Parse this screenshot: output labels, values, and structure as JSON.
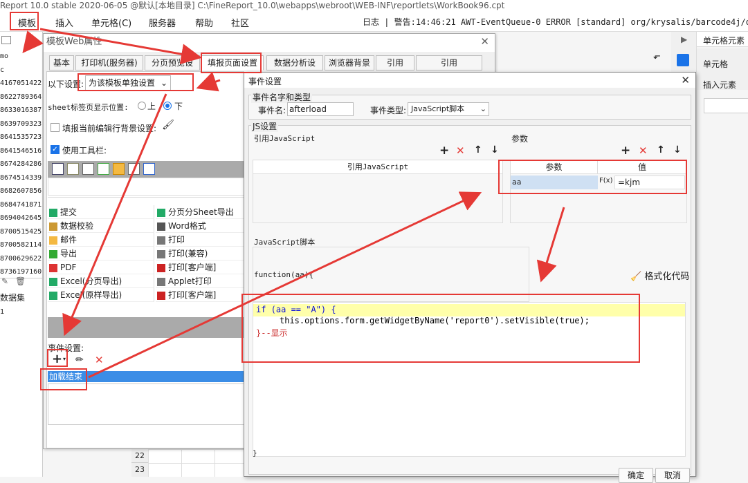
{
  "titlebar": {
    "text": "Report 10.0 stable 2020-06-05 @默认[本地目录]    C:\\FineReport_10.0\\webapps\\webroot\\WEB-INF\\reportlets\\WorkBook96.cpt"
  },
  "menubar": {
    "items": [
      "模板",
      "插入",
      "单元格(C)",
      "服务器",
      "帮助",
      "社区"
    ],
    "log": "日志 | 警告:14:46:21 AWT-EventQueue-0 ERROR [standard] org/krysalis/barcode4j/output/CanvasPro"
  },
  "left_panel": {
    "rows": [
      "mo",
      "c",
      "4167051422",
      "8622789364",
      "8633016387",
      "8639709323",
      "8641535723",
      "8641546516",
      "8674284286",
      "8674514339",
      "8682607856",
      "8684741871",
      "8694042645",
      "8700515425",
      "8700582114",
      "8700629622",
      "8736197160"
    ],
    "dataset_label": "数据集",
    "dataset_row": "1"
  },
  "grid_rows": [
    "22",
    "23"
  ],
  "right_panel": {
    "title": "单元格元素",
    "cell_label": "单元格",
    "insert_label": "插入元素"
  },
  "web_dialog": {
    "title": "模板Web属性",
    "tabs": [
      "基本",
      "打印机(服务器)",
      "分页预览设置",
      "填报页面设置",
      "数据分析设置",
      "浏览器背景",
      "引用Css",
      "引用JavaScript"
    ],
    "setting_label": "以下设置:",
    "setting_value": "为该模板单独设置",
    "sheet_pos_label": "sheet标签页显示位置:",
    "sheet_pos_up": "上",
    "sheet_pos_down": "下",
    "bg_label": "填报当前编辑行背景设置:",
    "toolbar_label": "使用工具栏:",
    "buttons": [
      "提交",
      "分页分Sheet导出",
      "数据校验",
      "Word格式",
      "邮件",
      "打印",
      "导出",
      "打印(兼容)",
      "PDF",
      "打印[客户端]",
      "Excel(分页导出)",
      "Applet打印",
      "Excel(原样导出)",
      "打印[客户端]"
    ],
    "event_label": "事件设置:",
    "event_item": "加载结束"
  },
  "event_dialog": {
    "title": "事件设置",
    "group_name": "事件名字和类型",
    "event_name_label": "事件名:",
    "event_name_value": "afterload",
    "event_type_label": "事件类型:",
    "event_type_value": "JavaScript脚本",
    "js_group": "JS设置",
    "ref_js_label": "引用JavaScript",
    "params_label": "参数",
    "ref_js_col": "引用JavaScript",
    "param_col": "参数",
    "value_col": "值",
    "param_name": "aa",
    "param_value": "=kjm",
    "formula_icon": "F(x)",
    "script_label": "JavaScript脚本",
    "func_sig": "function(aa){",
    "format_btn": "格式化代码",
    "code_if": "if (aa == \"A\") {",
    "code_body": "this.options.form.getWidgetByName('report0').setVisible(true);",
    "code_end": "}--显示",
    "close_brace": "}",
    "ok": "确定",
    "cancel": "取消"
  },
  "colors": {
    "accent": "#1a73e8",
    "red": "#e53935",
    "selected": "#3b8de6"
  }
}
